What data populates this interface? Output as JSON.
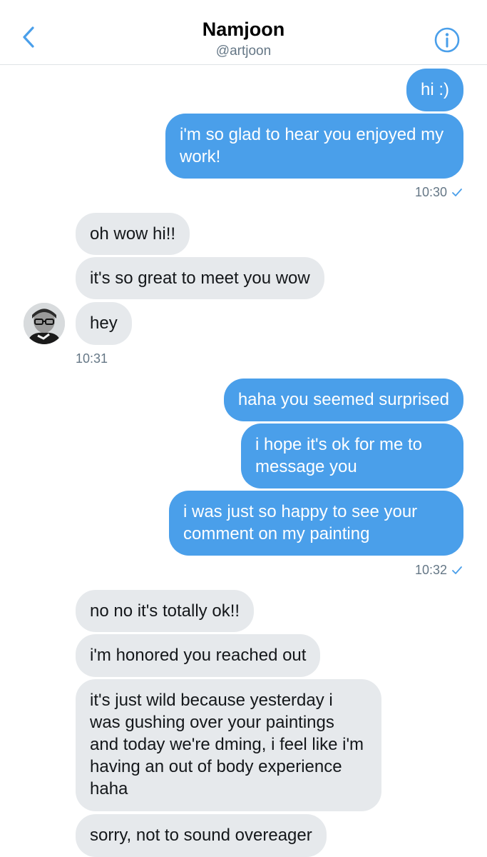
{
  "header": {
    "title": "Namjoon",
    "handle": "@artjoon",
    "back_icon": "chevron-left-icon",
    "info_icon": "info-circle-icon",
    "accent_color": "#4a9fea"
  },
  "messages": [
    {
      "side": "out",
      "text": "hi :)"
    },
    {
      "side": "out",
      "text": "i'm so glad to hear you enjoyed my work!"
    },
    {
      "side": "out",
      "time": "10:30",
      "read": true
    },
    {
      "side": "in",
      "text": "oh wow hi!!"
    },
    {
      "side": "in",
      "text": "it's so great to meet you wow"
    },
    {
      "side": "in",
      "text": "hey"
    },
    {
      "side": "in",
      "time": "10:31"
    },
    {
      "side": "out",
      "text": "haha you seemed surprised"
    },
    {
      "side": "out",
      "text": "i hope it's ok for me to message you"
    },
    {
      "side": "out",
      "text": "i was just so happy to see your comment on my painting"
    },
    {
      "side": "out",
      "time": "10:32",
      "read": true
    },
    {
      "side": "in",
      "text": "no no it's totally ok!!"
    },
    {
      "side": "in",
      "text": "i'm honored you reached out"
    },
    {
      "side": "in",
      "text": "it's just wild because yesterday i was gushing over your paintings and today we're dming, i feel like i'm having an out of body experience haha"
    },
    {
      "side": "in",
      "text": "sorry, not to sound overeager"
    }
  ],
  "colors": {
    "outgoing_bubble": "#4a9fea",
    "incoming_bubble": "#e6e9ec",
    "timestamp": "#657786"
  }
}
